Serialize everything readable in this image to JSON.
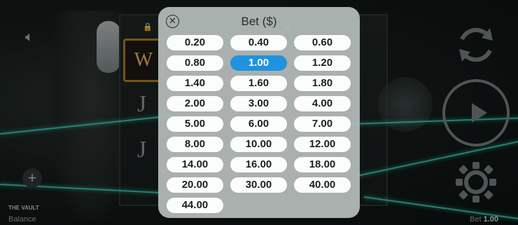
{
  "game": {
    "logo": "THE VAULT",
    "balance_label": "Balance",
    "bet_label": "Bet",
    "bet_value": "1.00"
  },
  "modal": {
    "title": "Bet ($)",
    "options": [
      "0.20",
      "0.40",
      "0.60",
      "0.80",
      "1.00",
      "1.20",
      "1.40",
      "1.60",
      "1.80",
      "2.00",
      "3.00",
      "4.00",
      "5.00",
      "6.00",
      "7.00",
      "8.00",
      "10.00",
      "12.00",
      "14.00",
      "16.00",
      "18.00",
      "20.00",
      "30.00",
      "40.00",
      "44.00"
    ],
    "selected": "1.00"
  },
  "colors": {
    "selected": "#1f93e0",
    "modal_bg": "#b0b7b5",
    "laser": "#3ff2d8"
  },
  "icons": {
    "close": "close-icon",
    "mute": "mute-icon",
    "refresh": "refresh-icon",
    "play": "play-icon",
    "autoplay": "autoplay-icon",
    "plus": "plus-icon"
  }
}
